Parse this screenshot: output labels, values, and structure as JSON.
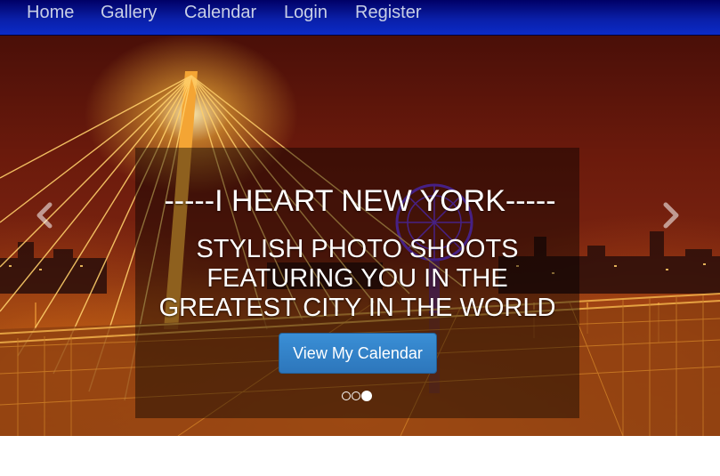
{
  "nav": {
    "items": [
      {
        "label": "Home"
      },
      {
        "label": "Gallery"
      },
      {
        "label": "Calendar"
      },
      {
        "label": "Login"
      },
      {
        "label": "Register"
      }
    ]
  },
  "carousel": {
    "headline": "-----I HEART NEW YORK-----",
    "subline": "STYLISH PHOTO SHOOTS FEATURING YOU IN THE GREATEST CITY IN THE WORLD",
    "cta_label": "View My Calendar",
    "slide_count": 3,
    "active_slide": 3,
    "prev_icon": "chevron-left-icon",
    "next_icon": "chevron-right-icon"
  },
  "colors": {
    "nav_bg": "#0a1fa8",
    "nav_text": "#c8cfe6",
    "button_bg": "#2d76bb",
    "ferris_wheel": "#7b3cff"
  }
}
